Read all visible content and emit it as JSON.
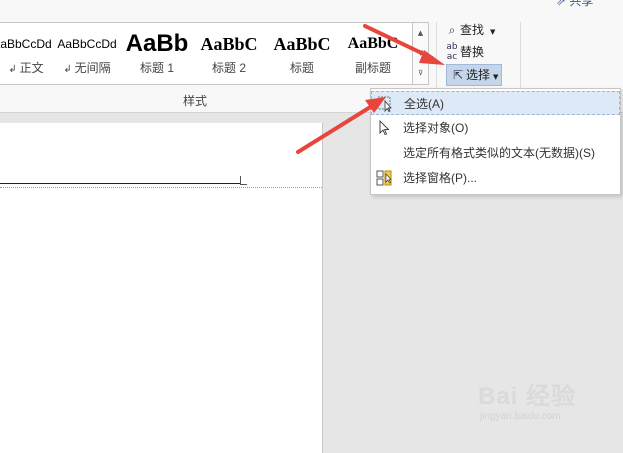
{
  "gallery": {
    "items": [
      {
        "preview": "AaBbCcDd",
        "name": "正文"
      },
      {
        "preview": "AaBbCcDd",
        "name": "无间隔"
      },
      {
        "preview": "AaBb",
        "name": "标题 1"
      },
      {
        "preview": "AaBbC",
        "name": "标题 2"
      },
      {
        "preview": "AaBbC",
        "name": "标题"
      },
      {
        "preview": "AaBbC",
        "name": "副标题"
      }
    ],
    "group_label": "样式"
  },
  "editing": {
    "find_label": "查找",
    "replace_label": "替换",
    "select_label": "选择"
  },
  "share_label": "共享",
  "select_menu": {
    "items": [
      {
        "label": "全选(A)",
        "icon": "select-all-icon"
      },
      {
        "label": "选择对象(O)",
        "icon": "pointer-icon"
      },
      {
        "label": "选定所有格式类似的文本(无数据)(S)",
        "icon": ""
      },
      {
        "label": "选择窗格(P)...",
        "icon": "selection-pane-icon"
      }
    ]
  },
  "watermark": {
    "brand": "Bai 经验",
    "url": "jingyan.baidu.com"
  },
  "colors": {
    "annotation_arrow": "#e8453c",
    "selected_button": "#c5d6ea",
    "menu_highlight": "#dde9f6"
  }
}
